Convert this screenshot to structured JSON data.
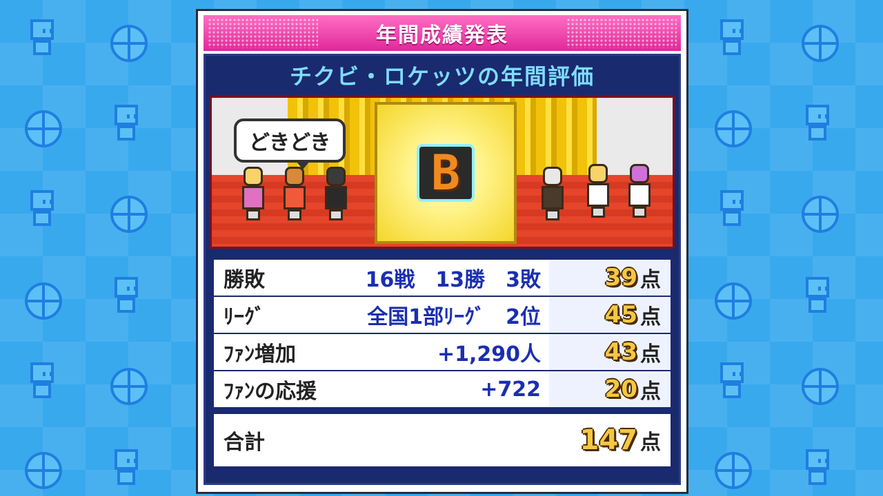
{
  "header": {
    "title": "年間成績発表",
    "subtitle": "チクビ・ロケッツの年間評価"
  },
  "stage": {
    "speech_bubble": "どきどき",
    "grade": "B"
  },
  "results": {
    "rows": [
      {
        "label": "勝敗",
        "value": "16戦　13勝　3敗",
        "score": "39",
        "unit": "点"
      },
      {
        "label": "ﾘｰｸﾞ",
        "value": "全国1部ﾘｰｸﾞ　2位",
        "score": "45",
        "unit": "点"
      },
      {
        "label": "ﾌｧﾝ増加",
        "value": "+1,290人",
        "score": "43",
        "unit": "点"
      },
      {
        "label": "ﾌｧﾝの応援",
        "value": "+722",
        "score": "20",
        "unit": "点"
      }
    ],
    "total": {
      "label": "合計",
      "score": "147",
      "unit": "点"
    }
  },
  "colors": {
    "background": "#39a9ee",
    "title_bar": "#e0289a",
    "inner_panel": "#1a2a6e",
    "subtitle_text": "#7fdcff",
    "value_text": "#1a2fb0",
    "score_gold": "#f5c842"
  }
}
